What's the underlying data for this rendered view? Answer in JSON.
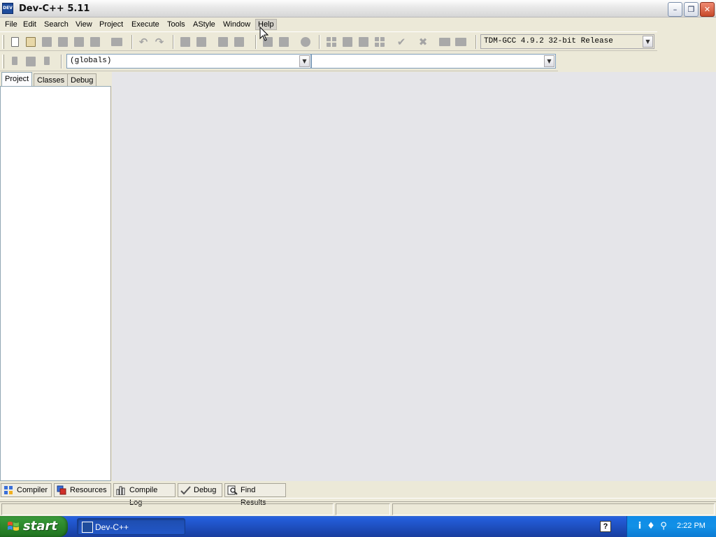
{
  "window": {
    "title": "Dev-C++ 5.11",
    "app_icon_text": "DEV",
    "controls": {
      "minimize": "–",
      "restore": "❐",
      "close": "✕"
    }
  },
  "menu": {
    "items": [
      "File",
      "Edit",
      "Search",
      "View",
      "Project",
      "Execute",
      "Tools",
      "AStyle",
      "Window",
      "Help"
    ],
    "hovered": "Help"
  },
  "toolbar": {
    "compiler_select": "TDM-GCC 4.9.2 32-bit Release",
    "scope_select": "(globals)",
    "member_select": ""
  },
  "left_panel": {
    "tabs": [
      "Project",
      "Classes",
      "Debug"
    ],
    "active_tab": "Project"
  },
  "bottom_panel": {
    "tabs": [
      "Compiler",
      "Resources",
      "Compile Log",
      "Debug",
      "Find Results"
    ]
  },
  "taskbar": {
    "start_label": "start",
    "task_label": "Dev-C++",
    "quick_help": "?",
    "clock": "2:22 PM"
  },
  "icons": {
    "tray": [
      "info-icon",
      "network-icon",
      "search-icon"
    ]
  },
  "colors": {
    "window_bg": "#ECE9D8",
    "editor_bg": "#E5E5E9",
    "taskbar_blue": "#245EDB",
    "start_green": "#2E8B2E",
    "tray_blue": "#1290E6"
  }
}
